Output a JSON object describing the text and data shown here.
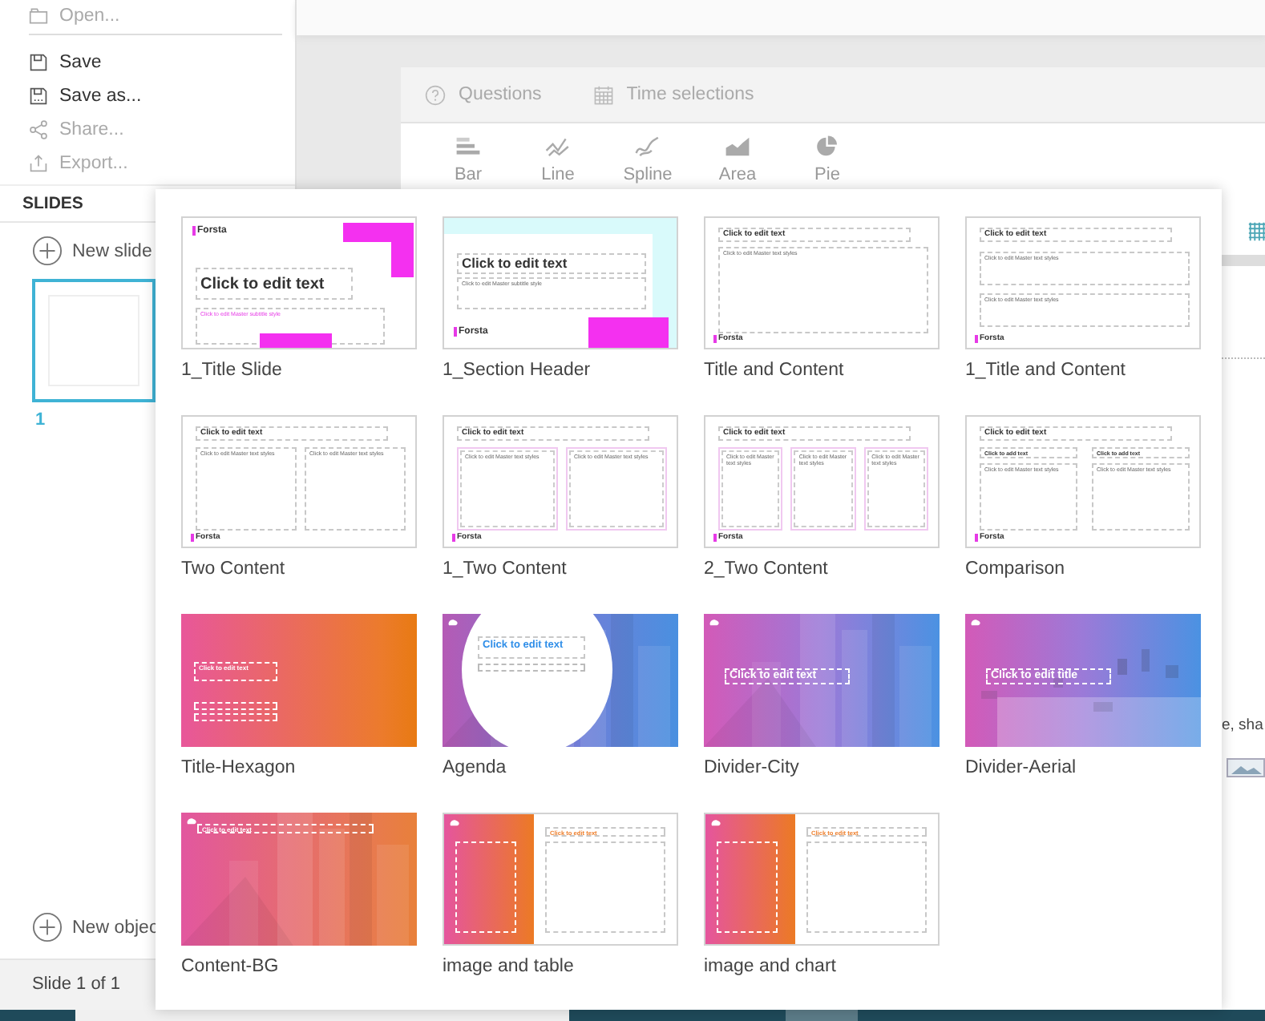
{
  "file_menu": [
    {
      "label": "Open...",
      "disabled": true
    },
    {
      "label": "Save",
      "disabled": false
    },
    {
      "label": "Save as...",
      "disabled": false
    },
    {
      "label": "Share...",
      "disabled": true
    },
    {
      "label": "Export...",
      "disabled": true
    }
  ],
  "slides_panel": {
    "heading": "SLIDES",
    "new_slide": "New slide",
    "slides": [
      {
        "number": "1",
        "selected": true
      }
    ],
    "new_object": "New objec",
    "status": "Slide 1 of 1"
  },
  "tabs": [
    {
      "label": "Questions"
    },
    {
      "label": "Time selections"
    }
  ],
  "chart_types": [
    {
      "label": "Bar"
    },
    {
      "label": "Line"
    },
    {
      "label": "Spline"
    },
    {
      "label": "Area"
    },
    {
      "label": "Pie"
    }
  ],
  "right_edge_text": "e, sha",
  "layouts": [
    {
      "name": "1_Title Slide",
      "kind": "title-slide",
      "logo": "Forsta",
      "title": "Click to edit text",
      "subtitle": "Click to edit Master subtitle style"
    },
    {
      "name": "1_Section Header",
      "kind": "section-header",
      "logo": "Forsta",
      "title": "Click to edit text",
      "subtitle": "Click to edit Master subtitle style"
    },
    {
      "name": "Title and Content",
      "kind": "title-content",
      "logo": "Forsta",
      "title": "Click to edit text",
      "body": [
        "Click to edit Master text styles"
      ]
    },
    {
      "name": "1_Title and Content",
      "kind": "title-rows",
      "logo": "Forsta",
      "title": "Click to edit text",
      "body": [
        "Click to edit Master text styles",
        "Click to edit Master text styles"
      ]
    },
    {
      "name": "Two Content",
      "kind": "columns",
      "logo": "Forsta",
      "title": "Click to edit text",
      "body": [
        "Click to edit Master text styles",
        "Click to edit Master text styles"
      ]
    },
    {
      "name": "1_Two Content",
      "kind": "framed-columns",
      "logo": "Forsta",
      "title": "Click to edit text",
      "body": [
        "Click to edit Master text styles",
        "Click to edit Master text styles"
      ]
    },
    {
      "name": "2_Two Content",
      "kind": "framed-columns",
      "logo": "Forsta",
      "title": "Click to edit text",
      "body": [
        "Click to edit Master text styles",
        "Click to edit Master text styles",
        "Click to edit Master text styles"
      ]
    },
    {
      "name": "Comparison",
      "kind": "comparison",
      "logo": "Forsta",
      "title": "Click to edit text",
      "subheads": [
        "Click to add text",
        "Click to add text"
      ],
      "body": [
        "Click to edit Master text styles",
        "Click to edit Master text styles"
      ]
    },
    {
      "name": "Title-Hexagon",
      "kind": "gradient-title",
      "title": "Click to edit text"
    },
    {
      "name": "Agenda",
      "kind": "agenda",
      "title": "Click to edit text"
    },
    {
      "name": "Divider-City",
      "kind": "divider",
      "title": "Click to edit text"
    },
    {
      "name": "Divider-Aerial",
      "kind": "divider",
      "title": "Click to edit title"
    },
    {
      "name": "Content-BG",
      "kind": "content-bg",
      "title": "Click to edit text"
    },
    {
      "name": "image and table",
      "kind": "image-split",
      "title": "Click to edit text"
    },
    {
      "name": "image and chart",
      "kind": "image-split",
      "title": "Click to edit text"
    }
  ]
}
